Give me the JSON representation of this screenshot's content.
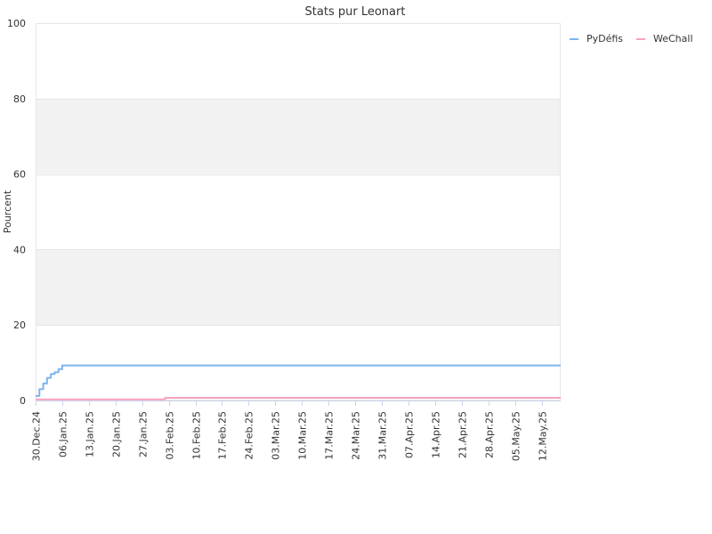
{
  "chart_data": {
    "type": "line",
    "title": "Stats pur Leonart",
    "ylabel": "Pourcent",
    "xlabel": "",
    "ylim": [
      0,
      100
    ],
    "yticks": [
      0,
      20,
      40,
      60,
      80,
      100
    ],
    "xlim": [
      "2024-12-30",
      "2025-05-17"
    ],
    "xtick_dates": [
      "2024-12-30",
      "2025-01-06",
      "2025-01-13",
      "2025-01-20",
      "2025-01-27",
      "2025-02-03",
      "2025-02-10",
      "2025-02-17",
      "2025-02-24",
      "2025-03-03",
      "2025-03-10",
      "2025-03-17",
      "2025-03-24",
      "2025-03-31",
      "2025-04-07",
      "2025-04-14",
      "2025-04-21",
      "2025-04-28",
      "2025-05-05",
      "2025-05-12"
    ],
    "xtick_labels": [
      "30.Dec.24",
      "06.Jan.25",
      "13.Jan.25",
      "20.Jan.25",
      "27.Jan.25",
      "03.Feb.25",
      "10.Feb.25",
      "17.Feb.25",
      "24.Feb.25",
      "03.Mar.25",
      "10.Mar.25",
      "17.Mar.25",
      "24.Mar.25",
      "31.Mar.25",
      "07.Apr.25",
      "14.Apr.25",
      "21.Apr.25",
      "28.Apr.25",
      "05.May.25",
      "12.May.25"
    ],
    "grid": true,
    "banded_background": true,
    "legend_position": "top-right",
    "series": [
      {
        "name": "PyDéfis",
        "color": "#7cb5ec",
        "step": true,
        "points": [
          [
            "2024-12-30",
            1.2
          ],
          [
            "2024-12-31",
            3.0
          ],
          [
            "2025-01-01",
            4.5
          ],
          [
            "2025-01-02",
            6.0
          ],
          [
            "2025-01-03",
            7.0
          ],
          [
            "2025-01-04",
            7.5
          ],
          [
            "2025-01-05",
            8.3
          ],
          [
            "2025-01-06",
            9.3
          ],
          [
            "2025-05-17",
            9.3
          ]
        ]
      },
      {
        "name": "WeChall",
        "color": "#f7a1c4",
        "step": true,
        "points": [
          [
            "2024-12-30",
            0.3
          ],
          [
            "2025-02-02",
            0.7
          ],
          [
            "2025-05-17",
            0.7
          ]
        ]
      }
    ]
  }
}
